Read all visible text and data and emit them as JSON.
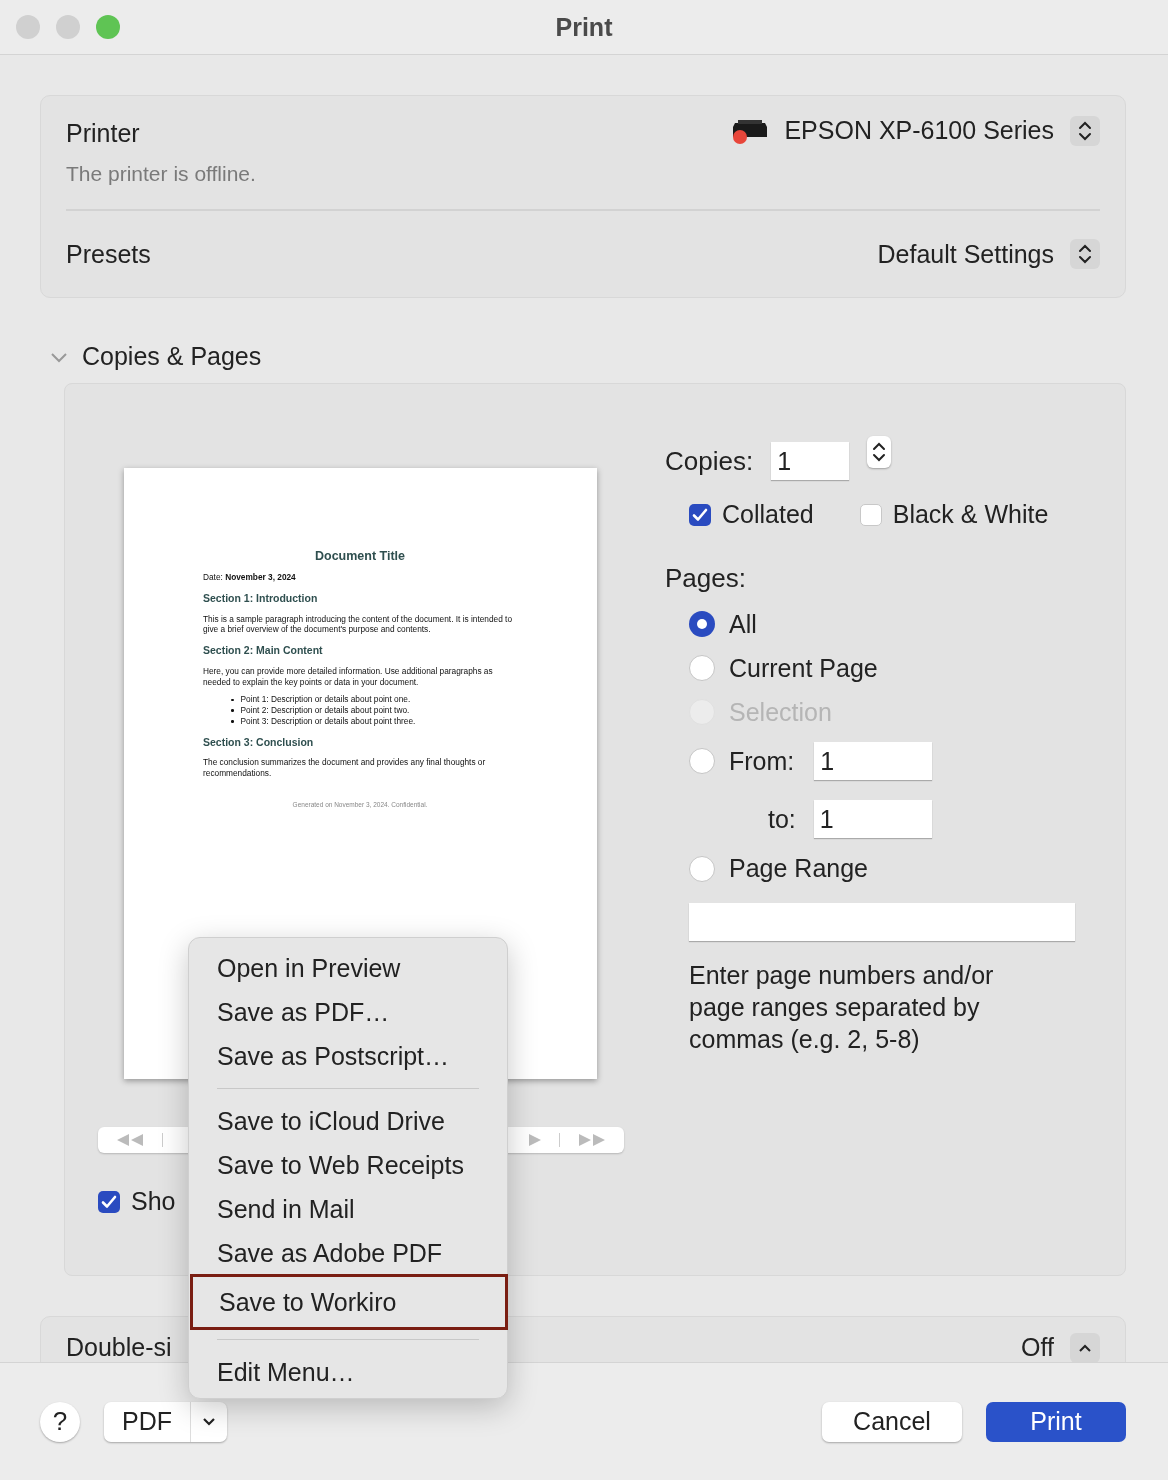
{
  "window": {
    "title": "Print"
  },
  "printer": {
    "label": "Printer",
    "status": "The printer is offline.",
    "name": "EPSON XP-6100 Series",
    "offline": true
  },
  "presets": {
    "label": "Presets",
    "value": "Default Settings"
  },
  "copies_pages": {
    "title": "Copies & Pages",
    "expanded": true,
    "preview": {
      "title": "Document Title",
      "date_label": "Date:",
      "date": "November 3, 2024",
      "sections": [
        {
          "heading": "Section 1: Introduction",
          "paragraph": "This is a sample paragraph introducing the content of the document. It is intended to give a brief overview of the document's purpose and contents."
        },
        {
          "heading": "Section 2: Main Content",
          "paragraph": "Here, you can provide more detailed information. Use additional paragraphs as needed to explain the key points or data in your document.",
          "bullets": [
            "Point 1: Description or details about point one.",
            "Point 2: Description or details about point two.",
            "Point 3: Description or details about point three."
          ]
        },
        {
          "heading": "Section 3: Conclusion",
          "paragraph": "The conclusion summarizes the document and provides any final thoughts or recommendations."
        }
      ],
      "footer": "Generated on November 3, 2024. Confidential."
    },
    "show_checkbox": {
      "label": "Sho",
      "checked": true
    },
    "copies": {
      "label": "Copies:",
      "value": "1"
    },
    "collated": {
      "label": "Collated",
      "checked": true
    },
    "black_white": {
      "label": "Black & White",
      "checked": false
    },
    "pages_label": "Pages:",
    "pages_options": [
      {
        "kind": "plain",
        "label": "All",
        "selected": true,
        "disabled": false
      },
      {
        "kind": "plain",
        "label": "Current Page",
        "selected": false,
        "disabled": false
      },
      {
        "kind": "plain",
        "label": "Selection",
        "selected": false,
        "disabled": true
      },
      {
        "kind": "from",
        "label": "From:",
        "value": "1",
        "to_label": "to:",
        "to_value": "1",
        "selected": false,
        "disabled": false
      },
      {
        "kind": "range",
        "label": "Page Range",
        "selected": false,
        "disabled": false
      }
    ],
    "range_hint": "Enter page numbers and/or page ranges separated by commas (e.g. 2, 5-8)"
  },
  "double_sided": {
    "label": "Double-si",
    "value": "Off"
  },
  "pdf_menu": {
    "groups": [
      [
        {
          "label": "Open in Preview",
          "outlined": false
        },
        {
          "label": "Save as PDF…",
          "outlined": false
        },
        {
          "label": "Save as Postscript…",
          "outlined": false
        }
      ],
      [
        {
          "label": "Save to iCloud Drive",
          "outlined": false
        },
        {
          "label": "Save to Web Receipts",
          "outlined": false
        },
        {
          "label": "Send in Mail",
          "outlined": false
        },
        {
          "label": "Save as Adobe PDF",
          "outlined": false
        },
        {
          "label": "Save to Workiro",
          "outlined": true
        }
      ],
      [
        {
          "label": "Edit Menu…",
          "outlined": false
        }
      ]
    ]
  },
  "buttons": {
    "help": "?",
    "pdf": "PDF",
    "cancel": "Cancel",
    "print": "Print"
  }
}
